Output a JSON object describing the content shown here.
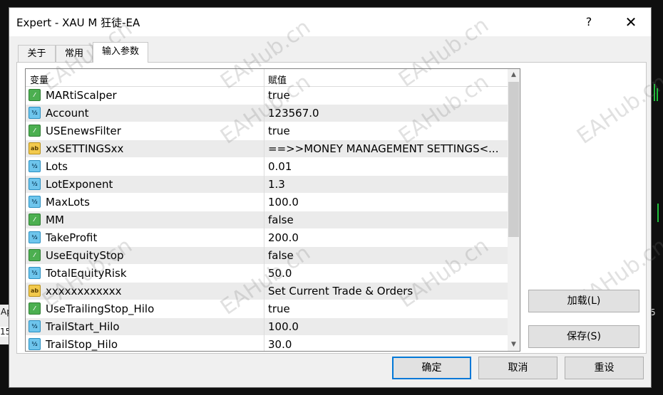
{
  "background": {
    "left_text_1": "Ap",
    "left_text_2": "15",
    "right_text": "5"
  },
  "dialog": {
    "title": "Expert - XAU M 狂徒-EA",
    "help_label": "?",
    "close_label": "✕"
  },
  "tabs": [
    {
      "label": "关于"
    },
    {
      "label": "常用"
    },
    {
      "label": "输入参数"
    }
  ],
  "grid": {
    "columns": [
      "变量",
      "赋值"
    ],
    "rows": [
      {
        "name": "MARtiScalper",
        "value": "true",
        "type": "bool"
      },
      {
        "name": "Account",
        "value": "123567.0",
        "type": "num"
      },
      {
        "name": "USEnewsFilter",
        "value": "true",
        "type": "bool"
      },
      {
        "name": "xxSETTINGSxx",
        "value": "==>>MONEY MANAGEMENT SETTINGS<...",
        "type": "str"
      },
      {
        "name": "Lots",
        "value": "0.01",
        "type": "num"
      },
      {
        "name": "LotExponent",
        "value": "1.3",
        "type": "num"
      },
      {
        "name": "MaxLots",
        "value": "100.0",
        "type": "num"
      },
      {
        "name": "MM",
        "value": "false",
        "type": "bool"
      },
      {
        "name": "TakeProfit",
        "value": "200.0",
        "type": "num"
      },
      {
        "name": "UseEquityStop",
        "value": "false",
        "type": "bool"
      },
      {
        "name": "TotalEquityRisk",
        "value": "50.0",
        "type": "num"
      },
      {
        "name": "xxxxxxxxxxxx",
        "value": "Set Current Trade & Orders",
        "type": "str"
      },
      {
        "name": "UseTrailingStop_Hilo",
        "value": "true",
        "type": "bool"
      },
      {
        "name": "TrailStart_Hilo",
        "value": "100.0",
        "type": "num"
      },
      {
        "name": "TrailStop_Hilo",
        "value": "30.0",
        "type": "num"
      }
    ],
    "icon_glyphs": {
      "bool": "⁄",
      "num": "½",
      "str": "ab"
    },
    "scroll_up": "▲",
    "scroll_down": "▼"
  },
  "side_buttons": {
    "load_label": "加载(L)",
    "save_label": "保存(S)"
  },
  "footer_buttons": {
    "ok_label": "确定",
    "cancel_label": "取消",
    "reset_label": "重设"
  },
  "watermark": "EAHub.cn",
  "colors": {
    "accent_focus": "#0078d7",
    "bool_icon": "#4caf50",
    "num_icon": "#6ec5ec",
    "str_icon": "#f2c94c"
  }
}
